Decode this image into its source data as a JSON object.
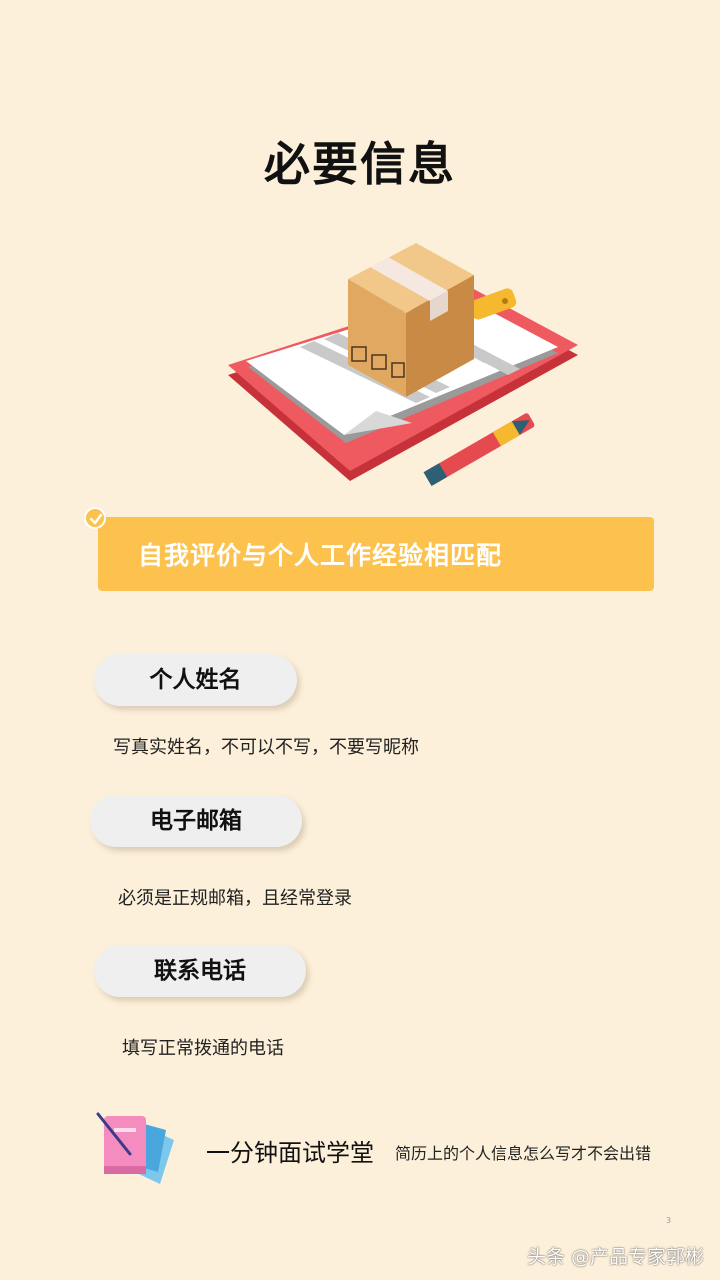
{
  "page_title": "必要信息",
  "banner": {
    "text": "自我评价与个人工作经验相匹配"
  },
  "fields": [
    {
      "label": "个人姓名",
      "description": "写真实姓名，不可以不写，不要写昵称"
    },
    {
      "label": "电子邮箱",
      "description": "必须是正规邮箱，且经常登录"
    },
    {
      "label": "联系电话",
      "description": "填写正常拨通的电话"
    }
  ],
  "footer": {
    "series": "一分钟面试学堂",
    "topic": "简历上的个人信息怎么写才不会出错"
  },
  "page_number": "3",
  "watermark": "头条 @产品专家郭彬",
  "colors": {
    "background": "#fdf0da",
    "accent": "#fcc24d",
    "pill": "#efefef",
    "clipboard_red": "#e8454d"
  },
  "icons": [
    "clipboard-box-illustration",
    "check-icon",
    "notebook-icon"
  ]
}
